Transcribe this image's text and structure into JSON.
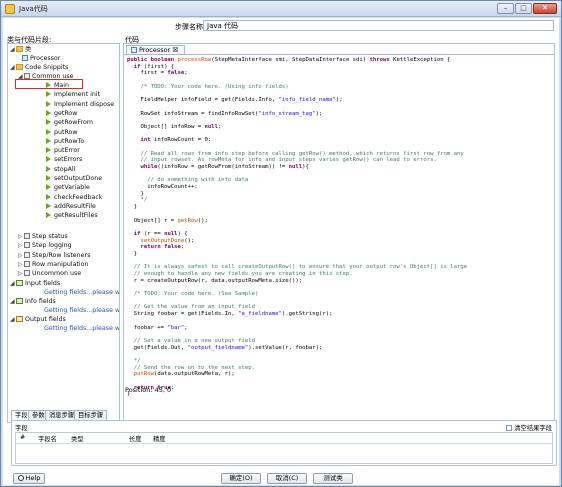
{
  "window": {
    "title": "Java代码",
    "min": "–",
    "max": "□",
    "close": "✕"
  },
  "step": {
    "name_label": "步骤名称",
    "name_value": "Java 代码"
  },
  "left_panel": {
    "label": "类与代码片段:"
  },
  "tree": {
    "classes": "类",
    "processor": "Processor",
    "code_snippits": "Code Snippits",
    "common_use": "Common use",
    "common_items": [
      "Main",
      "Implement init",
      "Implement dispose",
      "getRow",
      "getRowFrom",
      "putRow",
      "putRowTo",
      "putError",
      "setErrors",
      "stopAll",
      "setOutputDone",
      "getVariable",
      "checkFeedback",
      "addResultFile",
      "getResultFiles"
    ],
    "categories": [
      "Step status",
      "Step logging",
      "Step/Row listeners",
      "Row manipulation",
      "Uncommon use"
    ],
    "input_fields": "Input fields",
    "info_fields": "Info fields",
    "output_fields": "Output fields",
    "getting_fields": "Getting fields...please wait"
  },
  "editor": {
    "label": "代码",
    "tab": "Processor",
    "tab_close": "☒",
    "lines": [
      "public boolean processRow(StepMetaInterface smi, StepDataInterface sdi) throws KettleException {",
      "  if (first) {",
      "    first = false;",
      "",
      "    /* TODO: Your code here. (Using info fields)",
      "",
      "    FieldHelper infoField = get(Fields.Info, \"info_field_name\");",
      "",
      "    RowSet infoStream = findInfoRowSet(\"info_stream_tag\");",
      "",
      "    Object[] infoRow = null;",
      "",
      "    int infoRowCount = 0;",
      "",
      "    // Read all rows from info step before calling getRow() method, which returns first row from any",
      "    // input rowset. As rowMeta for info and input steps varies getRow() can lead to errors.",
      "    while((infoRow = getRowFrom(infoStream)) != null){",
      "",
      "      // do something with info data",
      "      infoRowCount++;",
      "    }",
      "    */",
      "  }",
      "",
      "  Object[] r = getRow();",
      "",
      "  if (r == null) {",
      "    setOutputDone();",
      "    return false;",
      "  }",
      "",
      "  // It is always safest to call createOutputRow() to ensure that your output row's Object[] is large",
      "  // enough to handle any new fields you are creating in this step.",
      "  r = createOutputRow(r, data.outputRowMeta.size());",
      "",
      "  /* TODO: Your code here. (See Sample)",
      "",
      "  // Get the value from an input field",
      "  String foobar = get(Fields.In, \"a_fieldname\").getString(r);",
      "",
      "  foobar += \"bar\";",
      "",
      "  // Set a value in a new output field",
      "  get(Fields.Out, \"output_fieldname\").setValue(r, foobar);",
      "",
      "  */",
      "  // Send the row on to the next step.",
      "  putRow(data.outputRowMeta, r);",
      "",
      "  return true;",
      "}"
    ],
    "position": "Position: 45, 0"
  },
  "bottom_tabs": [
    "字段",
    "参数",
    "消息步骤",
    "目标步骤"
  ],
  "fields": {
    "label": "字段",
    "clear_label": "清空结果字段",
    "columns": [
      "#",
      "字段名",
      "类型",
      "长度",
      "精度"
    ]
  },
  "buttons": {
    "help": "Help",
    "ok": "确定(O)",
    "cancel": "取消(C)",
    "test": "测试类"
  }
}
